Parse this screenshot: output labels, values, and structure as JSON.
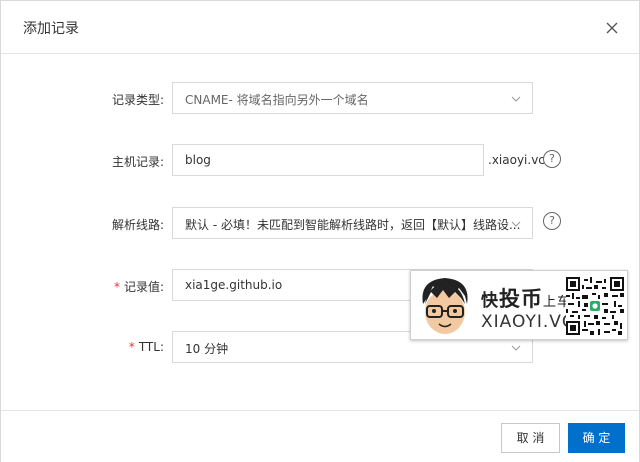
{
  "dialog": {
    "title": "添加记录",
    "close_icon": "close-icon"
  },
  "form": {
    "record_type": {
      "label": "记录类型:",
      "value": "CNAME- 将域名指向另外一个域名"
    },
    "host": {
      "label": "主机记录:",
      "value": "blog",
      "suffix": ".xiaoyi.vc",
      "help": "?"
    },
    "line": {
      "label": "解析线路:",
      "value": "默认 - 必填！未匹配到智能解析线路时，返回【默认】线路设...",
      "help": "?"
    },
    "record_value": {
      "required_mark": "*",
      "label": "记录值:",
      "value": "xia1ge.github.io"
    },
    "ttl": {
      "required_mark": "*",
      "label": "TTL:",
      "value": "10 分钟"
    }
  },
  "footer": {
    "cancel_label": "取 消",
    "ok_label": "确 定"
  },
  "watermark": {
    "title_1": "快",
    "title_2": "投币",
    "title_3": "上车",
    "subtitle": "XIAOYI.VC"
  },
  "colors": {
    "primary": "#0070cc",
    "required": "#e4393c",
    "border": "#d9d9d9"
  }
}
